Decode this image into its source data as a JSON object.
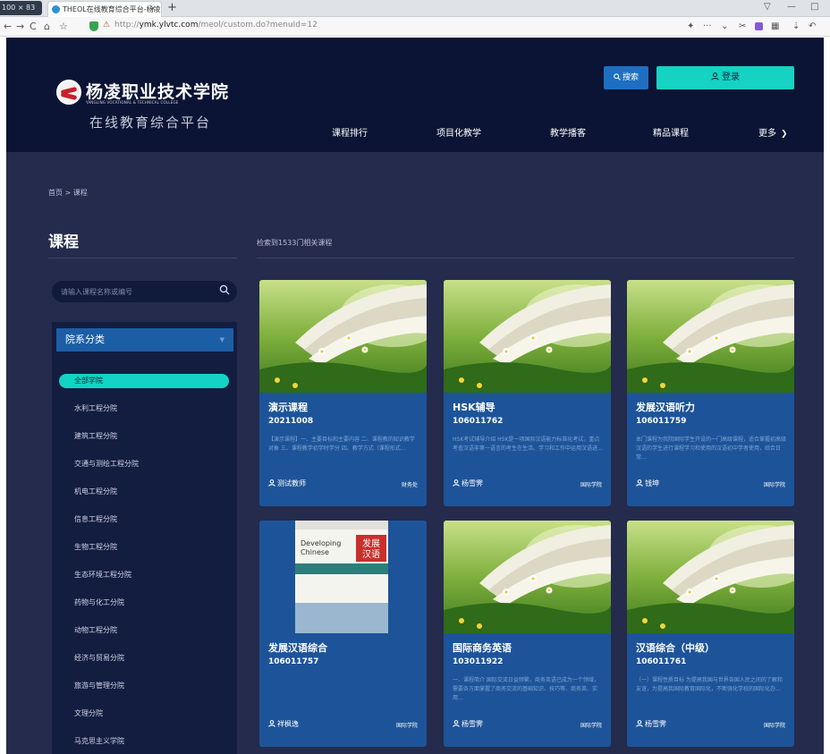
{
  "browser": {
    "zoom_label": "100 × 83",
    "tab_title": "THEOL在线教育综合平台-杨凌…",
    "tab_close": "×",
    "new_tab": "+",
    "url_host": "ymk.ylvtc.com",
    "url_prefix": "http://",
    "url_path": "/meol/custom.do?menuId=12",
    "nav_back": "←",
    "nav_forward": "→",
    "nav_reload": "C",
    "nav_home": "⌂",
    "nav_star": "☆",
    "win_controls": [
      "▽",
      "—",
      "□"
    ]
  },
  "header": {
    "school_name": "杨凌职业技术学院",
    "school_name_en": "YANGLING VOCATIONAL & TECHNICAL COLLEGE",
    "platform": "在线教育综合平台",
    "search_label": "搜索",
    "login_label": "登录",
    "nav": [
      "课程排行",
      "项目化教学",
      "教学播客",
      "精品课程",
      "更多"
    ]
  },
  "breadcrumb": "首页  >  课程",
  "page_title": "课程",
  "result_count": "检索到1533门相关课程",
  "search": {
    "placeholder": "请输入课程名称或编号"
  },
  "sidebar": {
    "header": "院系分类",
    "selected": "全部学院",
    "items": [
      "水利工程分院",
      "建筑工程分院",
      "交通与测绘工程分院",
      "机电工程分院",
      "信息工程分院",
      "生物工程分院",
      "生态环境工程分院",
      "药物与化工分院",
      "动物工程分院",
      "经济与贸易分院",
      "旅游与管理分院",
      "文理分院",
      "马克思主义学院"
    ]
  },
  "courses": [
    {
      "title": "演示课程",
      "code": "20211008",
      "desc": "【演示课程】一、主要目标和主要内容 二、课程教的知识教学对象 三、课程教学初学时学分 四、教学方式（课程形式…",
      "teacher": "测试教师",
      "dept": "财务处",
      "image": "book-meadow"
    },
    {
      "title": "HSK辅导",
      "code": "106011762",
      "desc": "HSK考试辅导介绍 HSK是一项国际汉语能力标准化考试，重点考查汉语非第一语言的考生在生活、学习和工作中运用汉语进…",
      "teacher": "杨雪霁",
      "dept": "国际学院",
      "image": "book-meadow"
    },
    {
      "title": "发展汉语听力",
      "code": "106011759",
      "desc": "本门课程为我院国际学生开设的一门高级课程，适合掌握初高级汉语的学生进行课程学习和使用的汉语初中学者使用，综合日常…",
      "teacher": "钱坤",
      "dept": "国际学院",
      "image": "book-meadow"
    },
    {
      "title": "发展汉语综合",
      "code": "106011757",
      "desc": "",
      "teacher": "祥枫逸",
      "dept": "国际学院",
      "image": "textbook"
    },
    {
      "title": "国际商务英语",
      "code": "103011922",
      "desc": "一、课程简介 国际交流日益频繁，商务英语已成为一个领域，需要各方面掌握了商务交流的基础知识、技巧等、商务英、实用…",
      "teacher": "杨雪霁",
      "dept": "国际学院",
      "image": "book-meadow"
    },
    {
      "title": "汉语综合（中级）",
      "code": "106011761",
      "desc": "（一）课程性质目标 为提高我国与世界各国人民之间的了解和友谊，为提高我国际教育国际化，不断强化学校的国际化办…",
      "teacher": "杨雪霁",
      "dept": "国际学院",
      "image": "book-meadow"
    }
  ],
  "textbook_cover": {
    "title_en_1": "Developing",
    "title_en_2": "Chinese",
    "title_cn_1": "发展",
    "title_cn_2": "汉语"
  },
  "colors": {
    "header_bg": "#0b1434",
    "page_bg": "#252b4c",
    "card_bg": "#1d5499",
    "accent": "#16d2c3",
    "search_btn": "#1e6fc2"
  }
}
